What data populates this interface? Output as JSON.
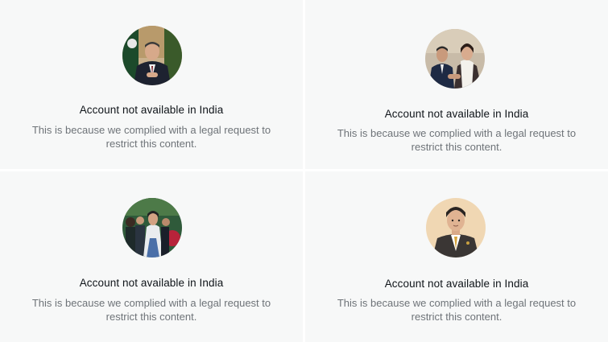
{
  "cards": [
    {
      "title": "Account not available in India",
      "line1": "This is because we complied with a legal request to",
      "line2": "restrict this content.",
      "avatar": "profile-photo-man-suit-flags"
    },
    {
      "title": "Account not available in India",
      "line1": "This is because we complied with a legal request to",
      "line2": "restrict this content.",
      "avatar": "profile-photo-couple"
    },
    {
      "title": "Account not available in India",
      "line1": "This is because we complied with a legal request to",
      "line2": "restrict this content.",
      "avatar": "profile-photo-crowd"
    },
    {
      "title": "Account not available in India",
      "line1": "This is because we complied with a legal request to",
      "line2": "restrict this content.",
      "avatar": "profile-illustration-man-suit"
    }
  ],
  "colors": {
    "card_bg": "#f7f8f8",
    "title": "#0f1419",
    "desc": "#6e7378"
  }
}
